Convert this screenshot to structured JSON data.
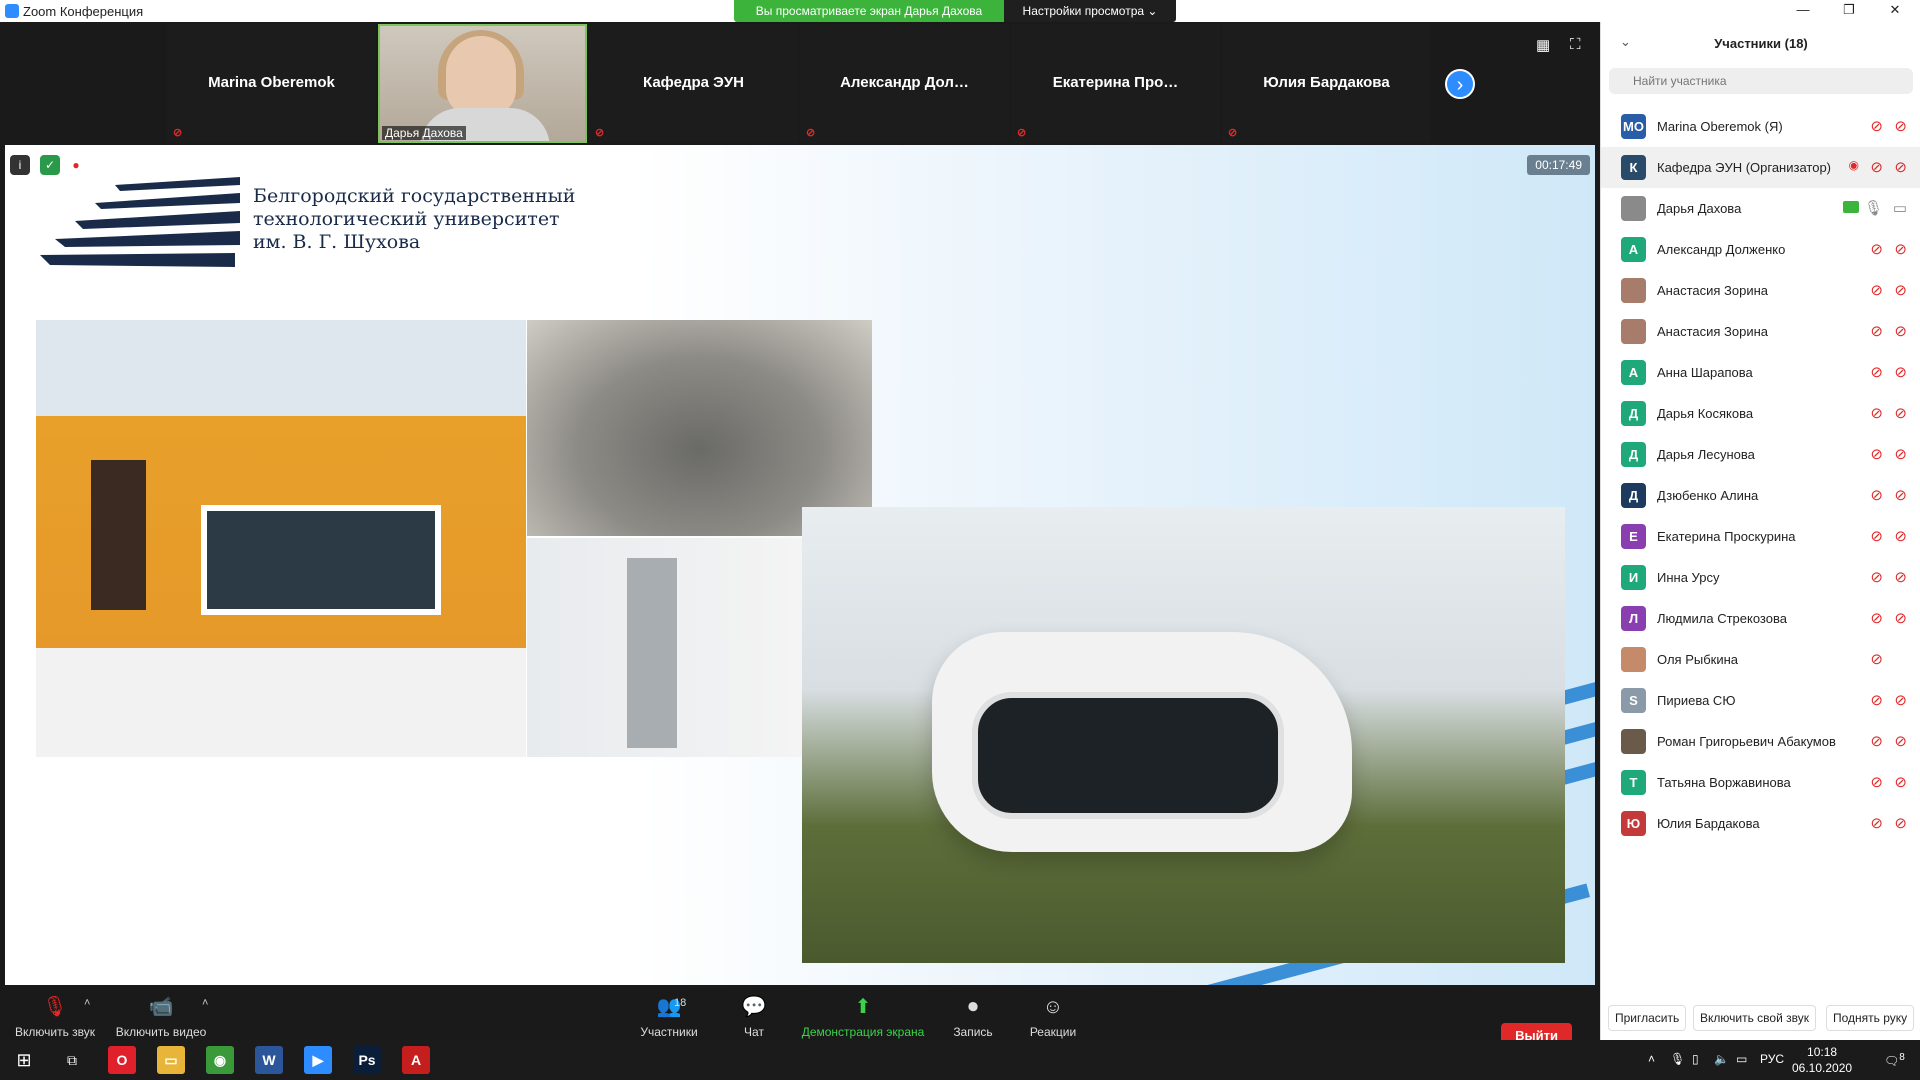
{
  "window": {
    "title": "Zoom Конференция",
    "share_banner": "Вы просматриваете экран Дарья Дахова",
    "view_options": "Настройки просмотра",
    "view_options_chevron": "⌄",
    "minimize": "—",
    "restore": "❐",
    "close": "✕"
  },
  "video_strip": {
    "tiles": [
      {
        "name": "Marina Oberemok",
        "muted": true
      },
      {
        "name": "Дарья Дахова",
        "has_video": true
      },
      {
        "name": "Кафедра ЭУН",
        "muted": true
      },
      {
        "name": "Александр  Дол…",
        "muted": true
      },
      {
        "name": "Екатерина  Про…",
        "muted": true
      },
      {
        "name": "Юлия Бардакова",
        "muted": true
      }
    ],
    "next_glyph": "›",
    "mic_muted_glyph": "⊘"
  },
  "share": {
    "timer": "00:17:49",
    "university": {
      "line1": "Белгородский государственный",
      "line2": "технологический университет",
      "line3": "им. В. Г. Шухова"
    }
  },
  "toolbar": {
    "unmute": "Включить звук",
    "start_video": "Включить видео",
    "participants": "Участники",
    "participants_count": "18",
    "chat": "Чат",
    "share_screen": "Демонстрация экрана",
    "record": "Запись",
    "reactions": "Реакции",
    "leave": "Выйти",
    "caret": "˄",
    "icons": {
      "mic": "🎙",
      "video": "📹",
      "people": "👥",
      "chat": "💬",
      "share": "⬆",
      "record": "⏺",
      "reactions": "☺"
    }
  },
  "panel": {
    "title": "Участники (18)",
    "chevron": "⌄",
    "search_placeholder": "Найти участника",
    "search_glyph": "🔍",
    "participants": [
      {
        "initials": "MO",
        "name": "Marina Oberemok (Я)",
        "color": "#2a5da8",
        "mic_off": true,
        "cam_off": true
      },
      {
        "initials": "К",
        "name": "Кафедра ЭУН (Организатор)",
        "color": "#2a4a6a",
        "mic_off": true,
        "cam_off": true,
        "recording": true,
        "highlighted": true
      },
      {
        "initials": "",
        "name": "Дарья Дахова",
        "color": "#8a8a8a",
        "sharing": true,
        "mic_on": true,
        "cam_on": true
      },
      {
        "initials": "А",
        "name": "Александр Долженко",
        "color": "#1fa87a",
        "mic_off": true,
        "cam_off": true
      },
      {
        "initials": "",
        "name": "Анастасия Зорина",
        "color": "#a87c6a",
        "mic_off": true,
        "cam_off": true
      },
      {
        "initials": "",
        "name": "Анастасия Зорина",
        "color": "#a87c6a",
        "mic_off": true,
        "cam_off": true
      },
      {
        "initials": "А",
        "name": "Анна Шарапова",
        "color": "#1fa87a",
        "mic_off": true,
        "cam_off": true
      },
      {
        "initials": "Д",
        "name": "Дарья Косякова",
        "color": "#1fa87a",
        "mic_off": true,
        "cam_off": true
      },
      {
        "initials": "Д",
        "name": "Дарья Лесунова",
        "color": "#1fa87a",
        "mic_off": true,
        "cam_off": true
      },
      {
        "initials": "Д",
        "name": "Дзюбенко Алина",
        "color": "#1e3a5f",
        "mic_off": true,
        "cam_off": true
      },
      {
        "initials": "Е",
        "name": "Екатерина Проскурина",
        "color": "#8a3fb0",
        "mic_off": true,
        "cam_off": true
      },
      {
        "initials": "И",
        "name": "Инна Урсу",
        "color": "#1fa87a",
        "mic_off": true,
        "cam_off": true
      },
      {
        "initials": "Л",
        "name": "Людмила Стрекозова",
        "color": "#8a3fb0",
        "mic_off": true,
        "cam_off": true
      },
      {
        "initials": "",
        "name": "Оля Рыбкина",
        "color": "#c48a6a",
        "mic_off": true
      },
      {
        "initials": "S",
        "name": "Пириева СЮ",
        "color": "#8a9aa8",
        "mic_off": true,
        "cam_off": true
      },
      {
        "initials": "",
        "name": "Роман Григорьевич Абакумов",
        "color": "#6a5a4a",
        "mic_off": true,
        "cam_off": true
      },
      {
        "initials": "Т",
        "name": "Татьяна Воржавинова",
        "color": "#1fa87a",
        "mic_off": true,
        "cam_off": true
      },
      {
        "initials": "Ю",
        "name": "Юлия Бардакова",
        "color": "#c43a3a",
        "mic_off": true,
        "cam_off": true
      }
    ],
    "footer": {
      "invite": "Пригласить",
      "unmute_me": "Включить свой звук",
      "raise_hand": "Поднять руку"
    }
  },
  "taskbar": {
    "time": "10:18",
    "date": "06.10.2020",
    "lang": "РУС",
    "notifications": "8",
    "start_glyph": "⊞",
    "taskview_glyph": "⧉",
    "up_glyph": "˄",
    "apps": [
      {
        "name": "opera",
        "glyph": "O",
        "color": "#e0202a"
      },
      {
        "name": "explorer",
        "glyph": "▭",
        "color": "#e8b53a"
      },
      {
        "name": "chrome",
        "glyph": "◉",
        "color": "#3a9a3a"
      },
      {
        "name": "word",
        "glyph": "W",
        "color": "#2b579a"
      },
      {
        "name": "zoom",
        "glyph": "▶",
        "color": "#2d8cff"
      },
      {
        "name": "photoshop",
        "glyph": "Ps",
        "color": "#0a1e3a"
      },
      {
        "name": "acrobat",
        "glyph": "A",
        "color": "#c41e1e"
      }
    ]
  },
  "glyphs": {
    "mic_off": "⊘",
    "cam_off": "⊘",
    "mic": "🎙",
    "cam": "▭",
    "record": "◉",
    "info": "i",
    "shield": "✓",
    "rec_dot": "●"
  }
}
